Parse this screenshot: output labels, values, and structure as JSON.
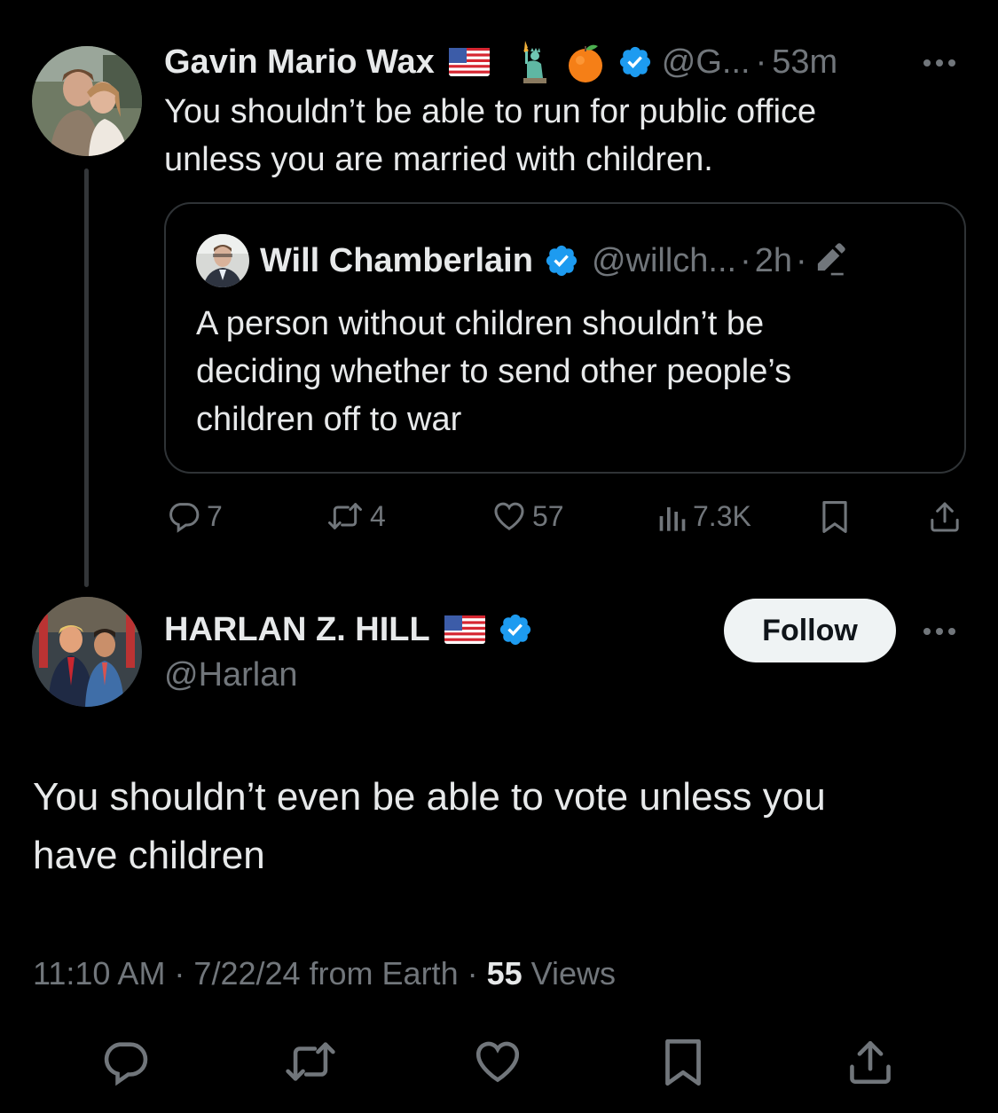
{
  "parent_tweet": {
    "author_name": "Gavin Mario Wax",
    "handle": "@G...",
    "time": "53m",
    "separator": "·",
    "text_line1": "You shouldn’t be able to run for public office",
    "text_line2": "unless you are married with children.",
    "icons": [
      "us-flag-icon",
      "statue-of-liberty-icon",
      "orange-icon",
      "verified-badge-icon",
      "more-options-icon"
    ]
  },
  "quoted_tweet": {
    "author_name": "Will Chamberlain",
    "handle": "@willch...",
    "time": "2h",
    "separator": "·",
    "text_line1": "A person without children shouldn’t be",
    "text_line2": "deciding whether to send other people’s",
    "text_line3": "children off to war",
    "icons": [
      "verified-badge-icon",
      "edit-pencil-icon"
    ]
  },
  "parent_actions": {
    "replies": "7",
    "reposts": "4",
    "likes": "57",
    "views": "7.3K"
  },
  "main_tweet": {
    "author_name": "HARLAN Z. HILL",
    "handle": "@Harlan",
    "follow_label": "Follow",
    "text_line1": "You shouldn’t even be able to vote unless you",
    "text_line2": "have children",
    "timestamp": "11:10 AM · 7/22/24 from Earth · ",
    "views_count": "55",
    "views_label": " Views",
    "icons": [
      "us-flag-icon",
      "verified-badge-icon",
      "more-options-icon"
    ]
  },
  "colors": {
    "background": "#000000",
    "text": "#e7e9ea",
    "muted": "#71767b",
    "verified": "#1d9bf0",
    "border": "#2f3336"
  }
}
